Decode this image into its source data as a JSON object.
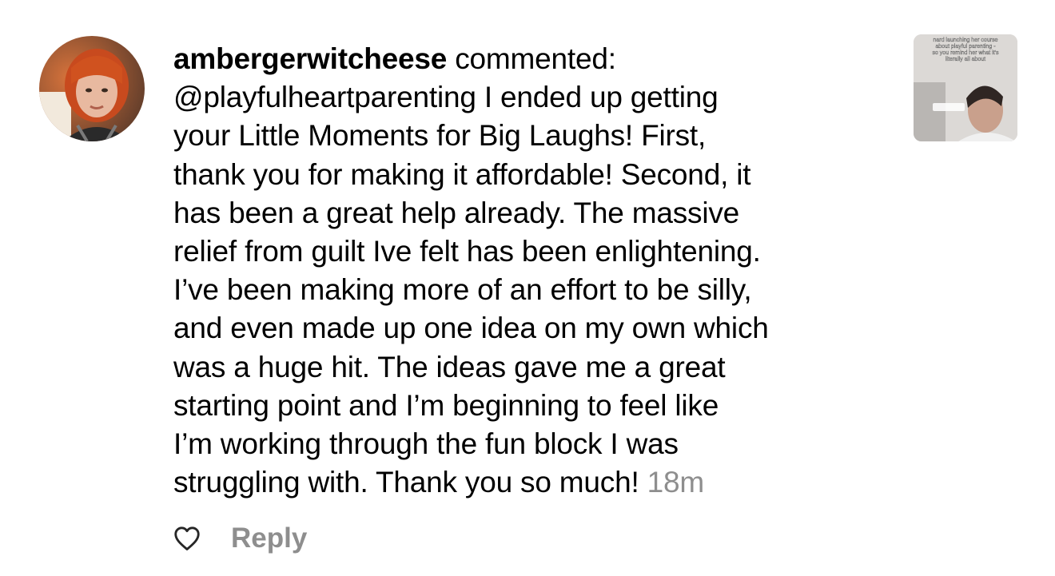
{
  "comment": {
    "username": "ambergerwitcheese",
    "action": "commented:",
    "lines": [
      "@playfulheartparenting I ended up getting",
      "your Little Moments for Big Laughs! First,",
      "thank you for making it affordable! Second, it",
      "has been a great help already. The massive",
      "relief from guilt Ive felt has been enlightening.",
      "I’ve been making more of an effort to be silly,",
      "and even made up one idea on my own which",
      "was a huge hit. The ideas gave me a great",
      "starting point and I’m beginning to feel like",
      "I’m working through the fun block I was",
      "struggling with. Thank you so much!"
    ],
    "timestamp": "18m"
  },
  "thumbnail": {
    "caption_lines": [
      "nard launching her course",
      "about playful parenting -",
      "so you remind her what it's",
      "literally all about"
    ]
  },
  "actions": {
    "reply_label": "Reply",
    "like_icon": "heart-outline-icon"
  },
  "colors": {
    "text": "#000000",
    "muted": "#8e8e8e",
    "background": "#ffffff"
  }
}
